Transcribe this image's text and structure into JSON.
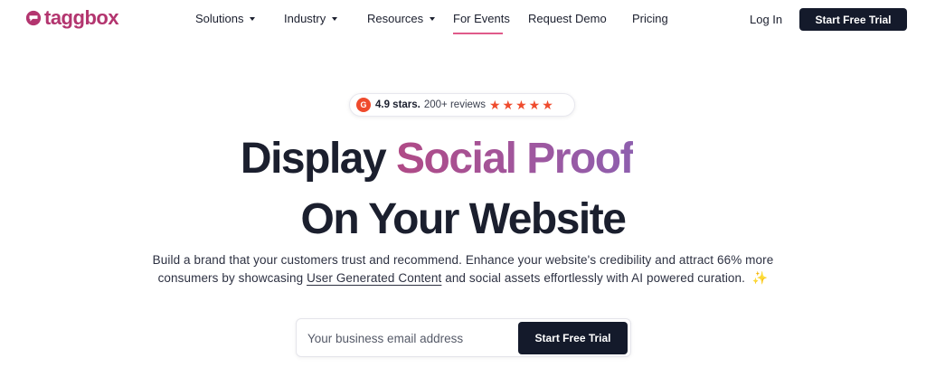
{
  "brand": {
    "name": "taggbox",
    "color": "#b3356f"
  },
  "nav": {
    "items": [
      {
        "label": "Solutions",
        "has_dropdown": true
      },
      {
        "label": "Industry",
        "has_dropdown": true
      },
      {
        "label": "Resources",
        "has_dropdown": true
      },
      {
        "label": "For Events",
        "has_dropdown": false,
        "active": true
      },
      {
        "label": "Request Demo",
        "has_dropdown": false
      },
      {
        "label": "Pricing",
        "has_dropdown": false
      }
    ],
    "login_label": "Log In",
    "cta_label": "Start Free Trial"
  },
  "rating": {
    "badge_icon": "g2-icon",
    "badge_letter": "G",
    "stars_text": "4.9 stars.",
    "reviews_text": "200+ reviews",
    "star_count": 5,
    "star_color": "#ef4b2d"
  },
  "hero": {
    "headline_line1_plain": "Display",
    "headline_line1_highlight": "Social Proof",
    "headline_line2": "On Your Website",
    "sub_line1": "Build a brand that your customers trust and recommend. Enhance your website's credibility and attract 66% more",
    "sub_line2_before": "consumers by showcasing",
    "sub_line2_link": "User Generated Content",
    "sub_line2_after": "and social assets effortlessly with AI powered curation.",
    "sparkle_icon": "sparkle-icon"
  },
  "form": {
    "email_placeholder": "Your business email address",
    "email_value": "",
    "cta_label": "Start Free Trial"
  },
  "colors": {
    "dark_button": "#141a2b",
    "accent_pink": "#e05a8a"
  }
}
